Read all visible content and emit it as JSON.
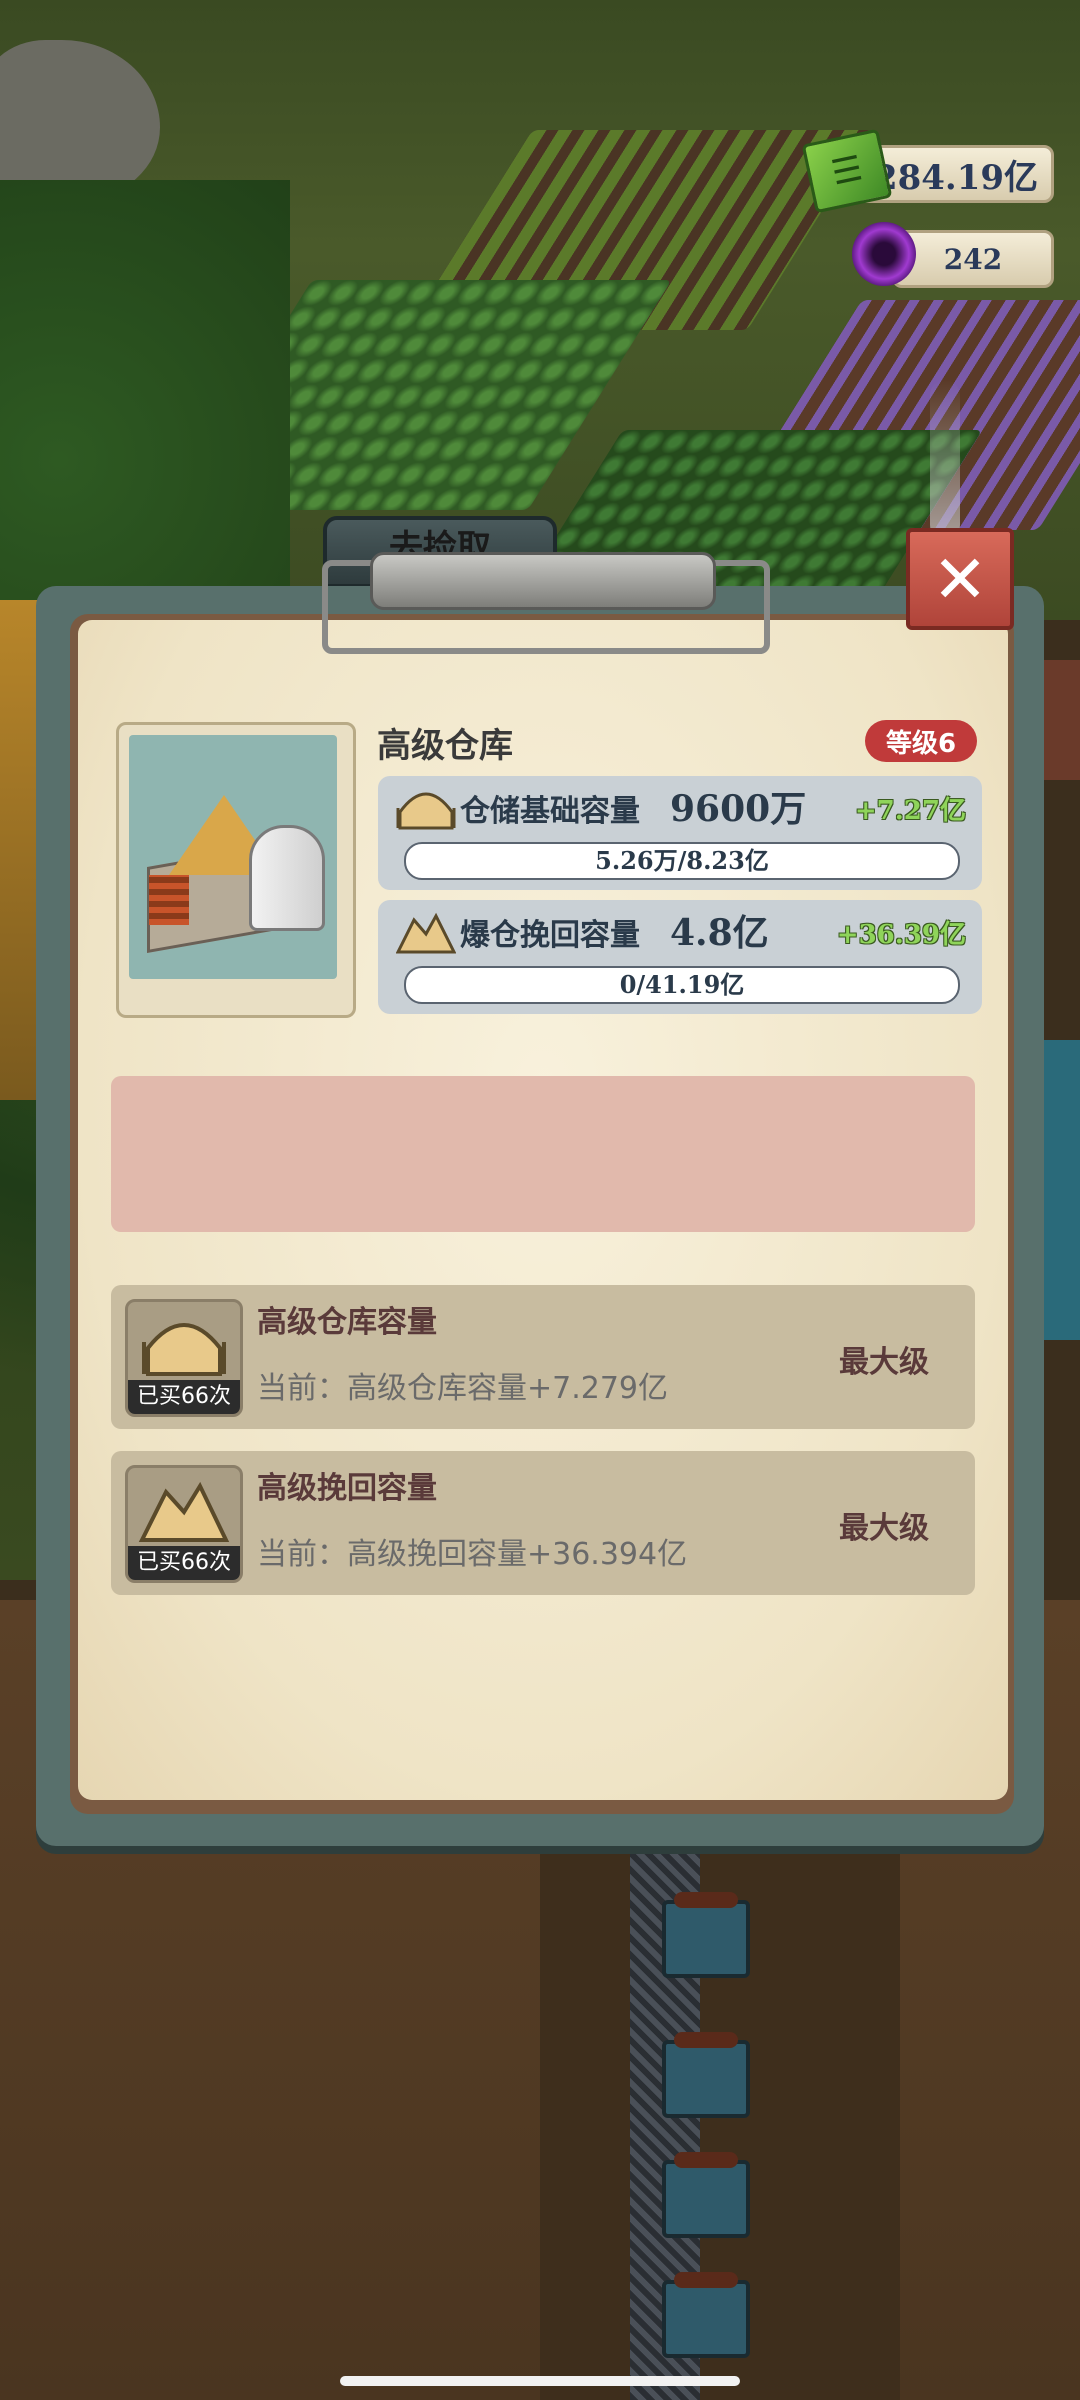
{
  "hud": {
    "cash_value": "284.19亿",
    "gem_value": "242"
  },
  "back_tab": {
    "label": "去捡取"
  },
  "panel": {
    "title": "高级仓库",
    "level": "等级6",
    "stats": [
      {
        "label": "仓储基础容量",
        "value": "9600万",
        "bonus": "+7.27亿",
        "bar_text": "5.26万/8.23亿",
        "progress": 0.0001
      },
      {
        "label": "爆仓挽回容量",
        "value": "4.8亿",
        "bonus": "+36.39亿",
        "bar_text": "0/41.19亿",
        "progress": 0.0
      }
    ]
  },
  "upgrades": [
    {
      "title": "高级仓库容量",
      "desc": "当前：高级仓库容量+7.279亿",
      "badge": "已买66次",
      "status": "最大级"
    },
    {
      "title": "高级挽回容量",
      "desc": "当前：高级挽回容量+36.394亿",
      "badge": "已买66次",
      "status": "最大级"
    }
  ],
  "colors": {
    "level_badge": "#c03a3a",
    "bonus_text": "#8fd45a",
    "close_button": "#c9564a"
  },
  "icons": [
    "cash-icon",
    "dark-gem-icon",
    "close-icon",
    "warehouse-capacity-icon",
    "recovery-capacity-icon"
  ]
}
